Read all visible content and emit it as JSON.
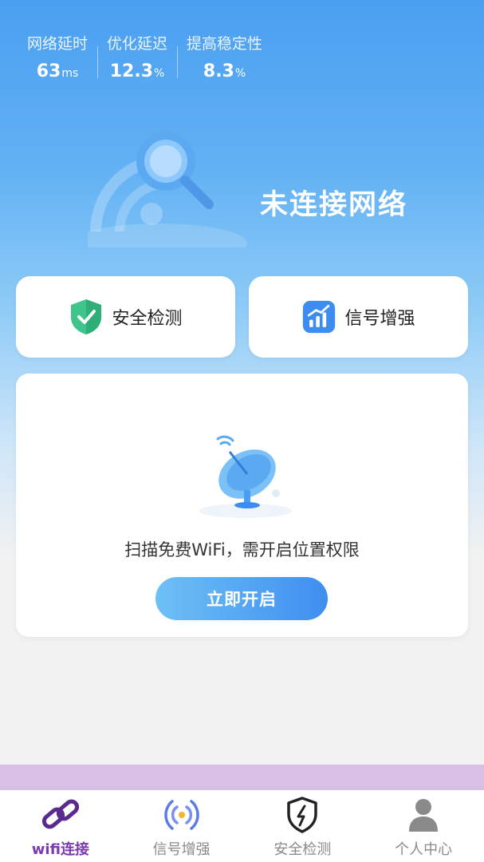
{
  "stats": [
    {
      "label": "网络延时",
      "value": "63",
      "unit": "ms"
    },
    {
      "label": "优化延迟",
      "value": "12.3",
      "unit": "%"
    },
    {
      "label": "提高稳定性",
      "value": "8.3",
      "unit": "%"
    }
  ],
  "hero": {
    "status": "未连接网络",
    "icon": "search-icon"
  },
  "quick_actions": [
    {
      "label": "安全检测",
      "icon": "shield-check-icon"
    },
    {
      "label": "信号增强",
      "icon": "signal-chart-icon"
    }
  ],
  "permission_card": {
    "message": "扫描免费WiFi，需开启位置权限",
    "button": "立即开启",
    "icon": "satellite-dish-icon"
  },
  "tabbar": [
    {
      "label": "wifi连接",
      "icon": "link-icon",
      "active": true
    },
    {
      "label": "信号增强",
      "icon": "signal-broadcast-icon",
      "active": false
    },
    {
      "label": "安全检测",
      "icon": "shield-bolt-icon",
      "active": false
    },
    {
      "label": "个人中心",
      "icon": "user-icon",
      "active": false
    }
  ],
  "colors": {
    "accent": "#4a9ff0",
    "active_tab": "#7b3ab0",
    "strip": "#d7bfe5"
  }
}
